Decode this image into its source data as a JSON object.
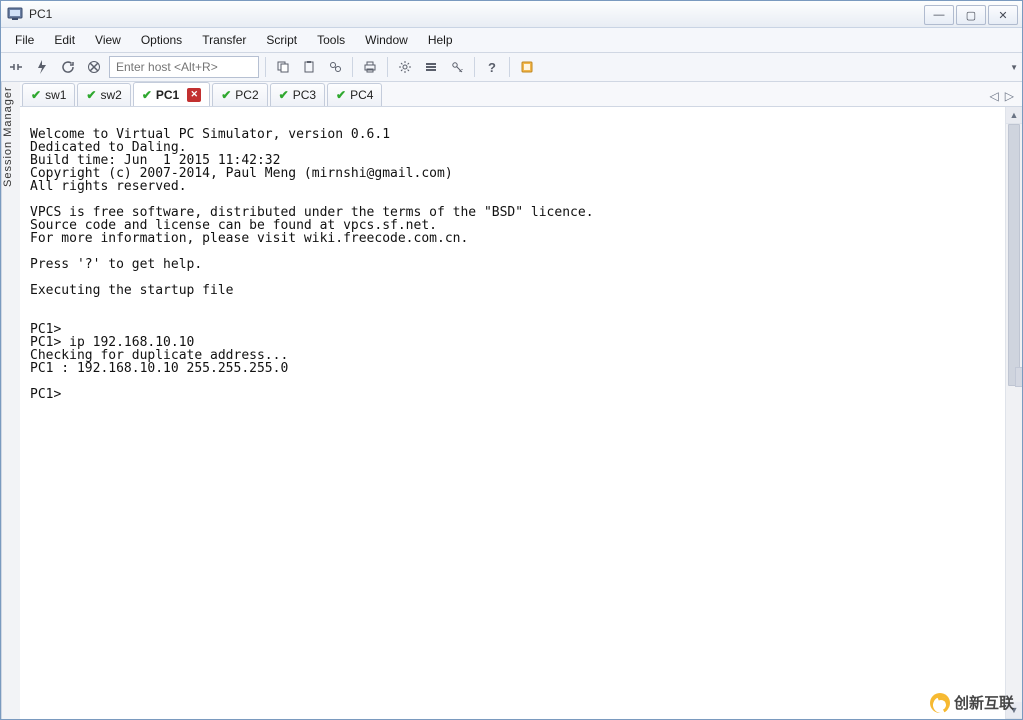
{
  "window": {
    "title": "PC1"
  },
  "menu": {
    "items": [
      "File",
      "Edit",
      "View",
      "Options",
      "Transfer",
      "Script",
      "Tools",
      "Window",
      "Help"
    ]
  },
  "toolbar": {
    "host_placeholder": "Enter host <Alt+R>"
  },
  "sidebar": {
    "label": "Session Manager"
  },
  "tabs": {
    "items": [
      {
        "label": "sw1",
        "active": false,
        "closable": false
      },
      {
        "label": "sw2",
        "active": false,
        "closable": false
      },
      {
        "label": "PC1",
        "active": true,
        "closable": true
      },
      {
        "label": "PC2",
        "active": false,
        "closable": false
      },
      {
        "label": "PC3",
        "active": false,
        "closable": false
      },
      {
        "label": "PC4",
        "active": false,
        "closable": false
      }
    ]
  },
  "terminal": {
    "content": "Welcome to Virtual PC Simulator, version 0.6.1\nDedicated to Daling.\nBuild time: Jun  1 2015 11:42:32\nCopyright (c) 2007-2014, Paul Meng (mirnshi@gmail.com)\nAll rights reserved.\n\nVPCS is free software, distributed under the terms of the \"BSD\" licence.\nSource code and license can be found at vpcs.sf.net.\nFor more information, please visit wiki.freecode.com.cn.\n\nPress '?' to get help.\n\nExecuting the startup file\n\n\nPC1>\nPC1> ip 192.168.10.10\nChecking for duplicate address...\nPC1 : 192.168.10.10 255.255.255.0\n\nPC1>"
  },
  "watermark": {
    "text": "创新互联"
  }
}
